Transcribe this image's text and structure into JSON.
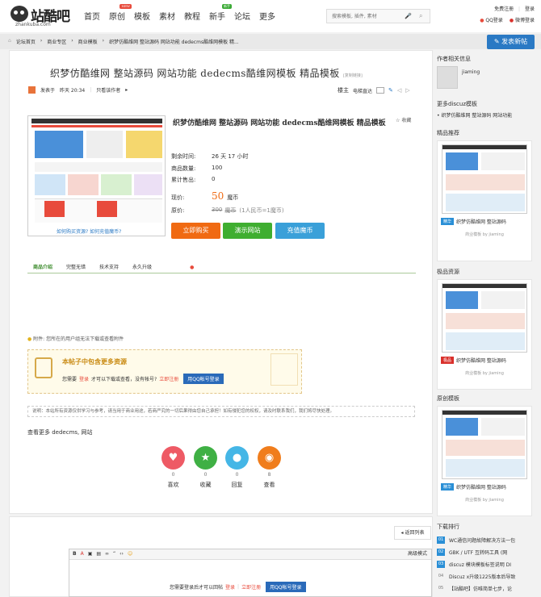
{
  "logo": {
    "text": "站酷吧",
    "sub": "zhankuba.com"
  },
  "nav": [
    {
      "label": "首页"
    },
    {
      "label": "原创",
      "badge": "NEW",
      "badge_color": "#e84b3c"
    },
    {
      "label": "模板"
    },
    {
      "label": "素材"
    },
    {
      "label": "教程"
    },
    {
      "label": "新手",
      "badge": "新手",
      "badge_color": "#3aaa35"
    },
    {
      "label": "论坛"
    },
    {
      "label": "更多"
    }
  ],
  "search": {
    "placeholder": "搜索模板, 插件, 素材"
  },
  "auth": {
    "register": "免费注册",
    "login": "登录",
    "qq_login": "QQ登录",
    "weibo_login": "微博登录"
  },
  "breadcrumb": [
    "论坛首页",
    "商业专区",
    "商业模板",
    "织梦仿酷维网 整站源码 网站功能 dedecms酷维网模板 精..."
  ],
  "post_new": "发表新帖",
  "thread": {
    "title": "织梦仿酷维网 整站源码 网站功能 dedecms酷维网模板 精品模板",
    "copy_link": "[复制链接]",
    "posted": "发表于",
    "time": "昨天 20:34",
    "only_author": "只看该作者",
    "floor": "楼主",
    "floor_jump": "电梯直达"
  },
  "product": {
    "title": "织梦仿酷维网 整站源码 网站功能 dedecms酷维网模板 精品模板",
    "favorite": "收藏",
    "rows": [
      {
        "k": "剩余时间:",
        "v": "26 天 17 小时"
      },
      {
        "k": "商品数量:",
        "v": "100"
      },
      {
        "k": "累计售出:",
        "v": "0"
      }
    ],
    "price_label": "现价:",
    "price": "50",
    "price_unit": "魔币",
    "orig_label": "原价:",
    "orig_price": "300",
    "orig_unit": "魔币",
    "rate": "(1人民币=1魔币)",
    "thumb_links": [
      "如何购买资源?",
      "如何充值魔币?"
    ],
    "buttons": [
      {
        "label": "立即购买",
        "color": "#f06a12"
      },
      {
        "label": "演示网站",
        "color": "#3fae30"
      },
      {
        "label": "充值魔币",
        "color": "#3aa0d9"
      }
    ]
  },
  "tabs": [
    {
      "label": "商品介绍",
      "active": true
    },
    {
      "label": "完整无错"
    },
    {
      "label": "技术支持"
    },
    {
      "label": "永久升级"
    }
  ],
  "attachment": {
    "label": "附件:",
    "text": "您所在的用户组无法下载或查看附件"
  },
  "hidden": {
    "title": "本帖子中包含更多资源",
    "need": "您需要",
    "login": "登录",
    "mid": "才可以下载或查看，没有帐号?",
    "register": "立即注册",
    "qq_btn": "用QQ帐号登录"
  },
  "notice": "说明：本站所有资源仅供学习与参考，请当用于商业用途，若商严究的一切后果得由您自己承担！如有侵犯您的权权，请及时联系我们，我们将尽快处理。",
  "more_tags": {
    "label": "查看更多",
    "tags": "dedecms, 网站"
  },
  "actions": [
    {
      "label": "喜欢",
      "count": "0",
      "color": "#ee5a65",
      "icon": "♥"
    },
    {
      "label": "收藏",
      "count": "0",
      "color": "#3fb044",
      "icon": "★"
    },
    {
      "label": "回复",
      "count": "0",
      "color": "#45b6e6",
      "icon": "●"
    },
    {
      "label": "查看",
      "count": "8",
      "color": "#f07d1c",
      "icon": "◉"
    }
  ],
  "back_list": "返回列表",
  "editor": {
    "advanced": "高级模式",
    "prompt": "您需要登录后才可以回帖",
    "login": "登录",
    "register": "立即注册",
    "qq_btn": "用QQ帐号登录"
  },
  "sidebar": {
    "author_info": "作者相关信息",
    "author": "jiaming",
    "more_discuz": "更多discuz模板",
    "more_discuz_item": "织梦仿酷维网 整站源码 网站功能",
    "sections": [
      {
        "title": "精品推荐",
        "tag": "精华",
        "tag_color": "#2a8fd6",
        "text": "织梦仿酷维网 整站源码",
        "by": "商业模板 by jiaming"
      },
      {
        "title": "极品资源",
        "tag": "极品",
        "tag_color": "#d9302b",
        "text": "织梦仿酷维网 整站源码",
        "by": "商业模板 by jiaming"
      },
      {
        "title": "原创模板",
        "tag": "精华",
        "tag_color": "#2a8fd6",
        "text": "织梦仿酷维网 整站源码",
        "by": "商业模板 by jiaming"
      }
    ],
    "downloads_title": "下载排行",
    "downloads": [
      {
        "n": "01",
        "text": "WC通信问题故障解决方法一包",
        "color": "#2a8fd6"
      },
      {
        "n": "02",
        "text": "GBK / UTF 互转码工具 (网",
        "color": "#2a8fd6"
      },
      {
        "n": "03",
        "text": "discuz 模块模板标签说明 DI",
        "color": "#2a8fd6"
      },
      {
        "n": "04",
        "text": "Discuz x升级1225版本后导致",
        "color": "#fff"
      },
      {
        "n": "05",
        "text": "【站酷吧】仿唯简单七步，论",
        "color": "#fff"
      }
    ]
  }
}
